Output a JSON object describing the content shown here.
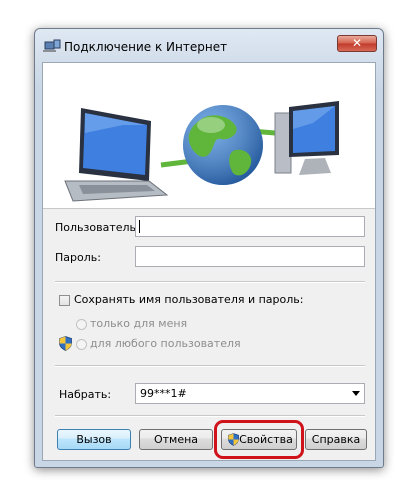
{
  "window": {
    "title": "Подключение к Интернет",
    "close_glyph": "✕",
    "icon": "network-connection-icon"
  },
  "banner": {
    "icons": [
      "laptop-icon",
      "globe-icon",
      "monitor-icon"
    ]
  },
  "form": {
    "username_label": "Пользователь:",
    "username_value": "",
    "password_label": "Пароль:",
    "password_value": "",
    "save_checkbox_label": "Сохранять имя пользователя и пароль:",
    "save_checked": false,
    "radio_only_me": "только для меня",
    "radio_any_user": "для любого пользователя",
    "dial_label": "Набрать:",
    "dial_value": "99***1#"
  },
  "buttons": {
    "dial": "Вызов",
    "cancel": "Отмена",
    "properties": "Свойства",
    "help": "Справка"
  },
  "colors": {
    "highlight": "#d0121b",
    "shield_blue": "#2f6fc3",
    "shield_yellow": "#f2c53d"
  }
}
